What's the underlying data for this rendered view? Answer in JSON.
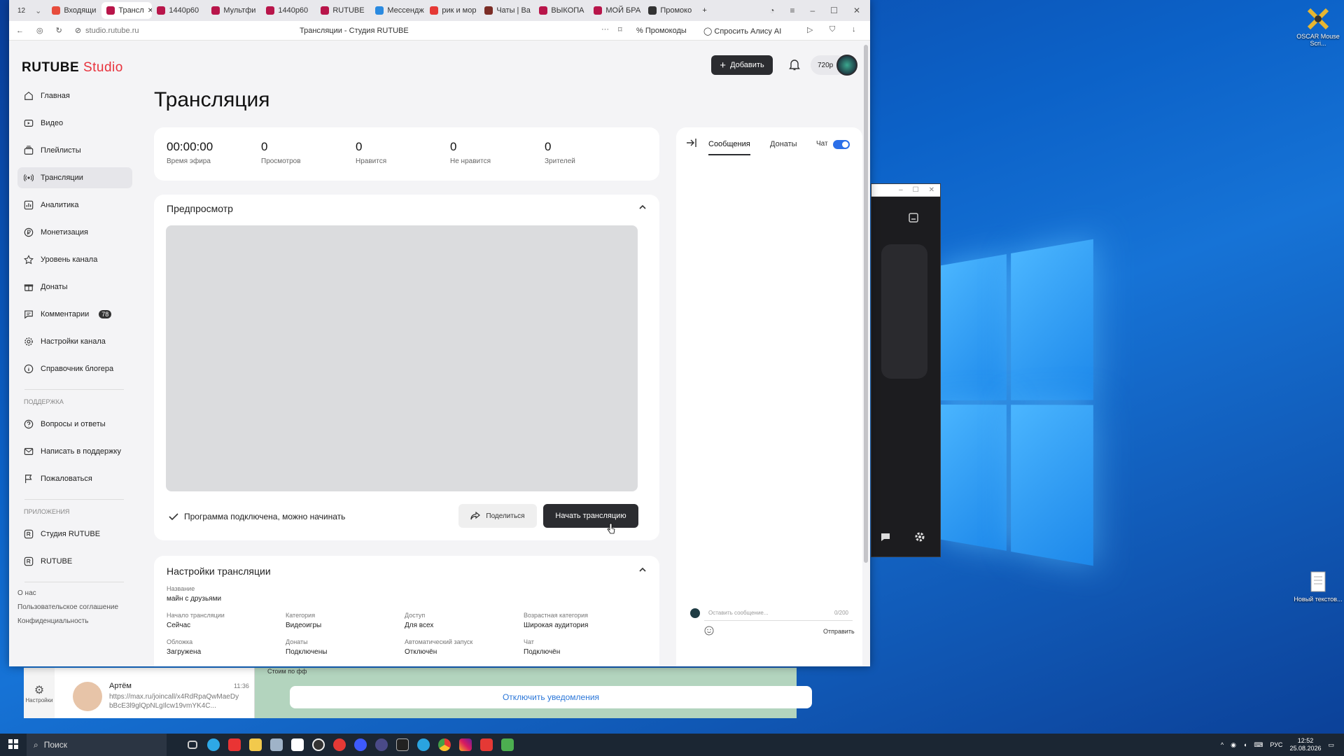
{
  "desktop": {
    "icons": [
      {
        "label": "OSCAR Mouse Scri...",
        "icon": "oscar-icon"
      },
      {
        "label": "Новый текстов...",
        "icon": "text-file-icon"
      }
    ]
  },
  "browser": {
    "tab_count": "12",
    "tabs": [
      {
        "label": "Входящи",
        "color": "#e74c3c"
      },
      {
        "label": "Трансл",
        "color": "#b8154a",
        "active": true
      },
      {
        "label": "1440p60",
        "color": "#b8154a"
      },
      {
        "label": "Мультфи",
        "color": "#b8154a"
      },
      {
        "label": "1440p60",
        "color": "#b8154a"
      },
      {
        "label": "RUTUBE",
        "color": "#b8154a"
      },
      {
        "label": "Мессендж",
        "color": "#2a8ae0"
      },
      {
        "label": "рик и мор",
        "color": "#e53935"
      },
      {
        "label": "Чаты | Ва",
        "color": "#7b2d26"
      },
      {
        "label": "ВЫКОПА",
        "color": "#b8154a"
      },
      {
        "label": "МОЙ БРА",
        "color": "#b8154a"
      },
      {
        "label": "Промоко",
        "color": "#333333"
      }
    ],
    "url": "studio.rutube.ru",
    "page_title": "Трансляции - Студия RUTUBE",
    "promo_label": "Промокоды",
    "alice_label": "Спросить Алису AI"
  },
  "studio": {
    "logo_main": "RUTUBE",
    "logo_sub": "Studio",
    "add_button": "Добавить",
    "quality": "720p",
    "nav": [
      {
        "label": "Главная",
        "icon": "home-icon"
      },
      {
        "label": "Видео",
        "icon": "video-icon"
      },
      {
        "label": "Плейлисты",
        "icon": "playlist-icon"
      },
      {
        "label": "Трансляции",
        "icon": "broadcast-icon",
        "active": true
      },
      {
        "label": "Аналитика",
        "icon": "analytics-icon"
      },
      {
        "label": "Монетизация",
        "icon": "ruble-icon"
      },
      {
        "label": "Уровень канала",
        "icon": "star-icon"
      },
      {
        "label": "Донаты",
        "icon": "gift-icon"
      },
      {
        "label": "Комментарии",
        "icon": "comment-icon",
        "badge": "78"
      },
      {
        "label": "Настройки канала",
        "icon": "gear-icon"
      },
      {
        "label": "Справочник блогера",
        "icon": "info-icon"
      }
    ],
    "support_title": "ПОДДЕРЖКА",
    "support": [
      {
        "label": "Вопросы и ответы",
        "icon": "question-icon"
      },
      {
        "label": "Написать в поддержку",
        "icon": "mail-icon"
      },
      {
        "label": "Пожаловаться",
        "icon": "flag-icon"
      }
    ],
    "apps_title": "ПРИЛОЖЕНИЯ",
    "apps": [
      {
        "label": "Студия RUTUBE",
        "icon": "studio-app-icon"
      },
      {
        "label": "RUTUBE",
        "icon": "rutube-app-icon"
      }
    ],
    "footer": [
      "О нас",
      "Пользовательское соглашение",
      "Конфиденциальность"
    ],
    "heading": "Трансляция",
    "stats": [
      {
        "value": "00:00:00",
        "label": "Время эфира"
      },
      {
        "value": "0",
        "label": "Просмотров"
      },
      {
        "value": "0",
        "label": "Нравится"
      },
      {
        "value": "0",
        "label": "Не нравится"
      },
      {
        "value": "0",
        "label": "Зрителей"
      }
    ],
    "preview": {
      "title": "Предпросмотр",
      "status": "Программа подключена, можно начинать",
      "share": "Поделиться",
      "start": "Начать трансляцию"
    },
    "settings": {
      "title": "Настройки трансляции",
      "name_label": "Название",
      "name_value": "майн с друзьями",
      "fields": [
        {
          "label": "Начало трансляции",
          "value": "Сейчас"
        },
        {
          "label": "Категория",
          "value": "Видеоигры"
        },
        {
          "label": "Доступ",
          "value": "Для всех"
        },
        {
          "label": "Возрастная категория",
          "value": "Широкая аудитория"
        },
        {
          "label": "Обложка",
          "value": "Загружена"
        },
        {
          "label": "Донаты",
          "value": "Подключены"
        },
        {
          "label": "Автоматический запуск",
          "value": "Отключён"
        },
        {
          "label": "Чат",
          "value": "Подключён"
        }
      ]
    },
    "chat": {
      "tabs": [
        "Сообщения",
        "Донаты"
      ],
      "chat_label": "Чат",
      "placeholder": "Оставить сообщение...",
      "counter": "0/200",
      "send": "Отправить"
    }
  },
  "messenger": {
    "settings_label": "Настройки",
    "contact_name": "Артём",
    "contact_time": "11:36",
    "contact_msg": "https://max.ru/joincall/x4RdRpaQwMaeDybBcE3l9glQpNLgIlcw19vmYK4C...",
    "notify": "Отключить уведомления",
    "fragment": "Стоим по фф"
  },
  "taskbar": {
    "search": "Поиск",
    "lang": "РУС",
    "time": "12:52",
    "date": "25.08.2026"
  }
}
